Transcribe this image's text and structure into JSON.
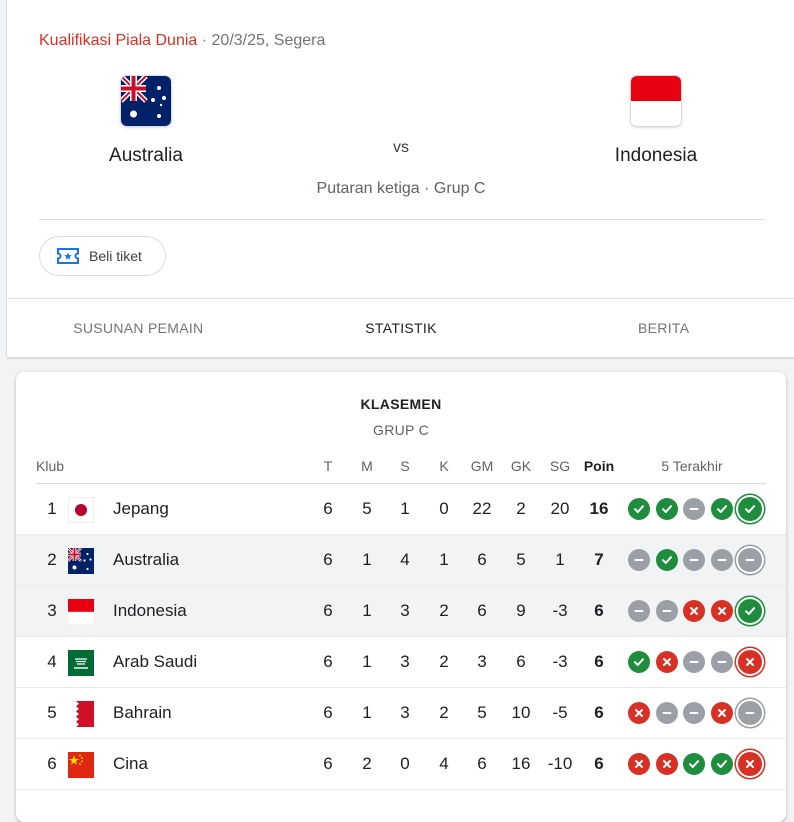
{
  "match": {
    "competition": "Kualifikasi Piala Dunia",
    "date_status": " · 20/3/25, Segera",
    "home_team": "Australia",
    "away_team": "Indonesia",
    "vs": "vs",
    "round": "Putaran ketiga · Grup C",
    "ticket_label": "Beli tiket"
  },
  "tabs": [
    {
      "label": "SUSUNAN PEMAIN",
      "active": false
    },
    {
      "label": "STATISTIK",
      "active": true
    },
    {
      "label": "BERITA",
      "active": false
    }
  ],
  "standings": {
    "title": "KLASEMEN",
    "group": "GRUP C",
    "headers": {
      "club": "Klub",
      "played": "T",
      "won": "M",
      "drawn": "S",
      "lost": "K",
      "gf": "GM",
      "ga": "GK",
      "gd": "SG",
      "points": "Poin",
      "form": "5 Terakhir"
    },
    "rows": [
      {
        "pos": "1",
        "team": "Jepang",
        "flag": "japan-flag-icon",
        "played": "6",
        "won": "5",
        "drawn": "1",
        "lost": "0",
        "gf": "22",
        "ga": "2",
        "gd": "20",
        "points": "16",
        "highlight": false,
        "form": [
          "W",
          "W",
          "D",
          "W",
          "W"
        ]
      },
      {
        "pos": "2",
        "team": "Australia",
        "flag": "australia-flag-icon",
        "played": "6",
        "won": "1",
        "drawn": "4",
        "lost": "1",
        "gf": "6",
        "ga": "5",
        "gd": "1",
        "points": "7",
        "highlight": true,
        "form": [
          "D",
          "W",
          "D",
          "D",
          "D"
        ]
      },
      {
        "pos": "3",
        "team": "Indonesia",
        "flag": "indonesia-flag-icon",
        "played": "6",
        "won": "1",
        "drawn": "3",
        "lost": "2",
        "gf": "6",
        "ga": "9",
        "gd": "-3",
        "points": "6",
        "highlight": true,
        "form": [
          "D",
          "D",
          "L",
          "L",
          "W"
        ]
      },
      {
        "pos": "4",
        "team": "Arab Saudi",
        "flag": "saudi-arabia-flag-icon",
        "played": "6",
        "won": "1",
        "drawn": "3",
        "lost": "2",
        "gf": "3",
        "ga": "6",
        "gd": "-3",
        "points": "6",
        "highlight": false,
        "form": [
          "W",
          "L",
          "D",
          "D",
          "L"
        ]
      },
      {
        "pos": "5",
        "team": "Bahrain",
        "flag": "bahrain-flag-icon",
        "played": "6",
        "won": "1",
        "drawn": "3",
        "lost": "2",
        "gf": "5",
        "ga": "10",
        "gd": "-5",
        "points": "6",
        "highlight": false,
        "form": [
          "L",
          "D",
          "D",
          "L",
          "D"
        ]
      },
      {
        "pos": "6",
        "team": "Cina",
        "flag": "china-flag-icon",
        "played": "6",
        "won": "2",
        "drawn": "0",
        "lost": "4",
        "gf": "6",
        "ga": "16",
        "gd": "-10",
        "points": "6",
        "highlight": false,
        "form": [
          "L",
          "L",
          "W",
          "W",
          "L"
        ]
      }
    ]
  },
  "colors": {
    "win": "#1e8e3e",
    "draw": "#9aa0a6",
    "loss": "#d93025",
    "competition_link": "#d93025",
    "highlight_row": "#f1f3f4"
  }
}
